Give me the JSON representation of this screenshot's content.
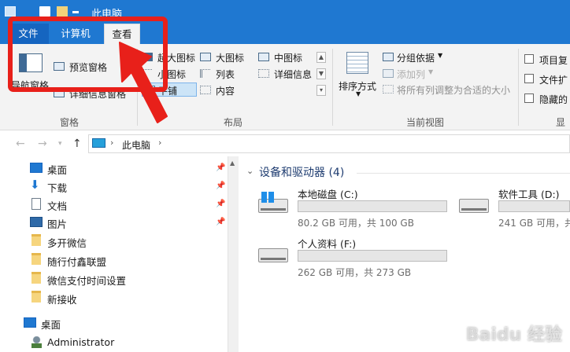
{
  "window": {
    "title": "此电脑"
  },
  "tabs": [
    {
      "label": "文件"
    },
    {
      "label": "计算机"
    },
    {
      "label": "查看"
    }
  ],
  "ribbon": {
    "panes": {
      "label": "窗格",
      "nav_pane": "导航窗格",
      "preview_pane": "预览窗格",
      "details_pane": "详细信息窗格"
    },
    "layout": {
      "label": "布局",
      "extra_large_icons": "超大图标",
      "large_icons": "大图标",
      "medium_icons": "中图标",
      "small_icons": "小图标",
      "list": "列表",
      "details": "详细信息",
      "tiles": "平铺",
      "content": "内容"
    },
    "current_view": {
      "label": "当前视图",
      "sort_by": "排序方式",
      "group_by": "分组依据",
      "add_columns": "添加列",
      "size_all_columns": "将所有列调整为合适的大小"
    },
    "show_hide": {
      "label": "显示",
      "item_checkboxes": "项目复",
      "file_extensions": "文件扩",
      "hidden_items": "隐藏的"
    }
  },
  "address": {
    "path": "此电脑"
  },
  "nav": {
    "quick_access": [
      {
        "label": "桌面",
        "pinned": true
      },
      {
        "label": "下载",
        "pinned": true
      },
      {
        "label": "文档",
        "pinned": true
      },
      {
        "label": "图片",
        "pinned": true
      },
      {
        "label": "多开微信"
      },
      {
        "label": "随行付鑫联盟"
      },
      {
        "label": "微信支付时间设置"
      },
      {
        "label": "新接收"
      }
    ],
    "desktop": "桌面",
    "user": "Administrator"
  },
  "content": {
    "group_title": "设备和驱动器 (4)",
    "drives": [
      {
        "name": "本地磁盘 (C:)",
        "free": "80.2 GB 可用，共 100 GB",
        "used_fraction": 0.198
      },
      {
        "name": "软件工具 (D:)",
        "free": "241 GB 可用，共",
        "used_fraction": 0.12
      },
      {
        "name": "个人资料 (F:)",
        "free": "262 GB 可用，共 273 GB",
        "used_fraction": 0.04
      }
    ]
  },
  "watermark": "Baidu 经验",
  "colors": {
    "titlebar": "#1f78d1",
    "drive_bar": "#26a0da",
    "highlight": "#e8201a"
  }
}
